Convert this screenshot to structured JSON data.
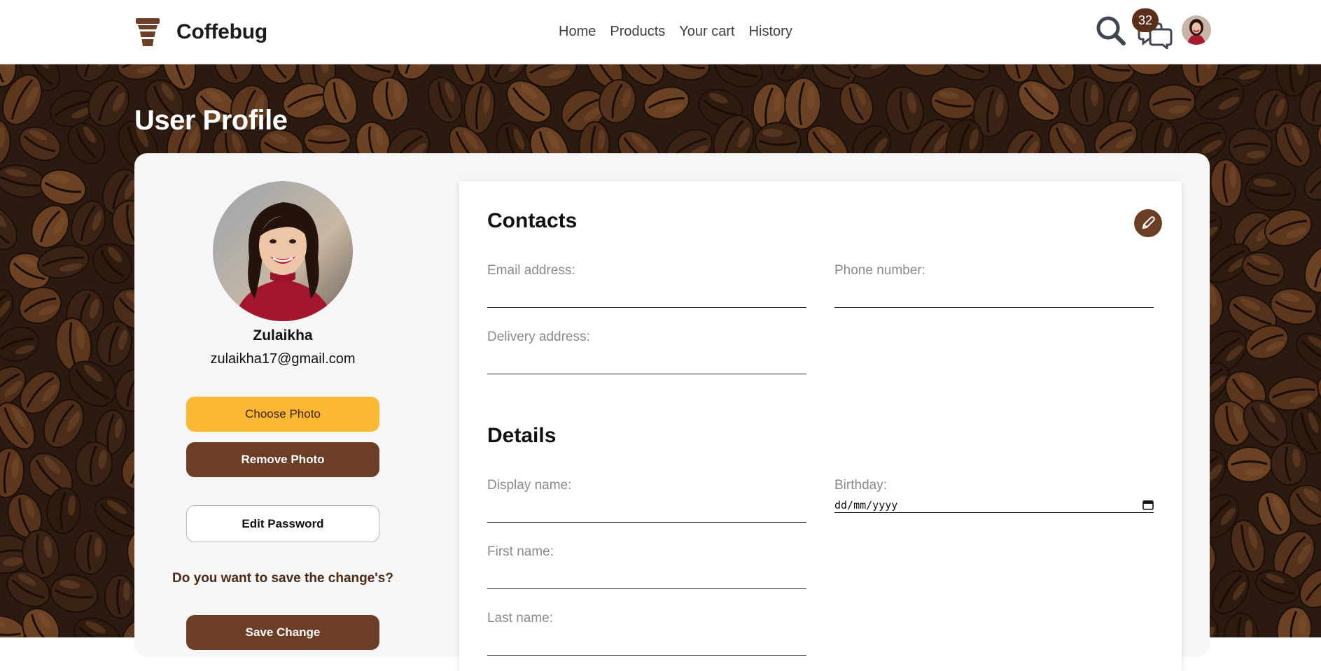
{
  "brand": {
    "name": "Coffebug"
  },
  "nav": {
    "links": [
      "Home",
      "Products",
      "Your cart",
      "History"
    ],
    "message_count": "32"
  },
  "page": {
    "title": "User Profile"
  },
  "profile": {
    "name": "Zulaikha",
    "email": "zulaikha17@gmail.com",
    "choose_photo": "Choose Photo",
    "remove_photo": "Remove Photo",
    "edit_password": "Edit Password",
    "save_question": "Do you want to save the change's?",
    "save_change": "Save Change"
  },
  "contacts": {
    "title": "Contacts",
    "email_label": "Email address:",
    "phone_label": "Phone number:",
    "delivery_label": "Delivery address:"
  },
  "details": {
    "title": "Details",
    "display_name_label": "Display name:",
    "birthday_label": "Birthday:",
    "birthday_placeholder": "dd/mm/yyyy",
    "first_name_label": "First name:",
    "last_name_label": "Last name:"
  },
  "colors": {
    "brand_brown": "#6b3e25",
    "accent_yellow": "#fdb833",
    "badge_brown": "#5a2f1a"
  }
}
